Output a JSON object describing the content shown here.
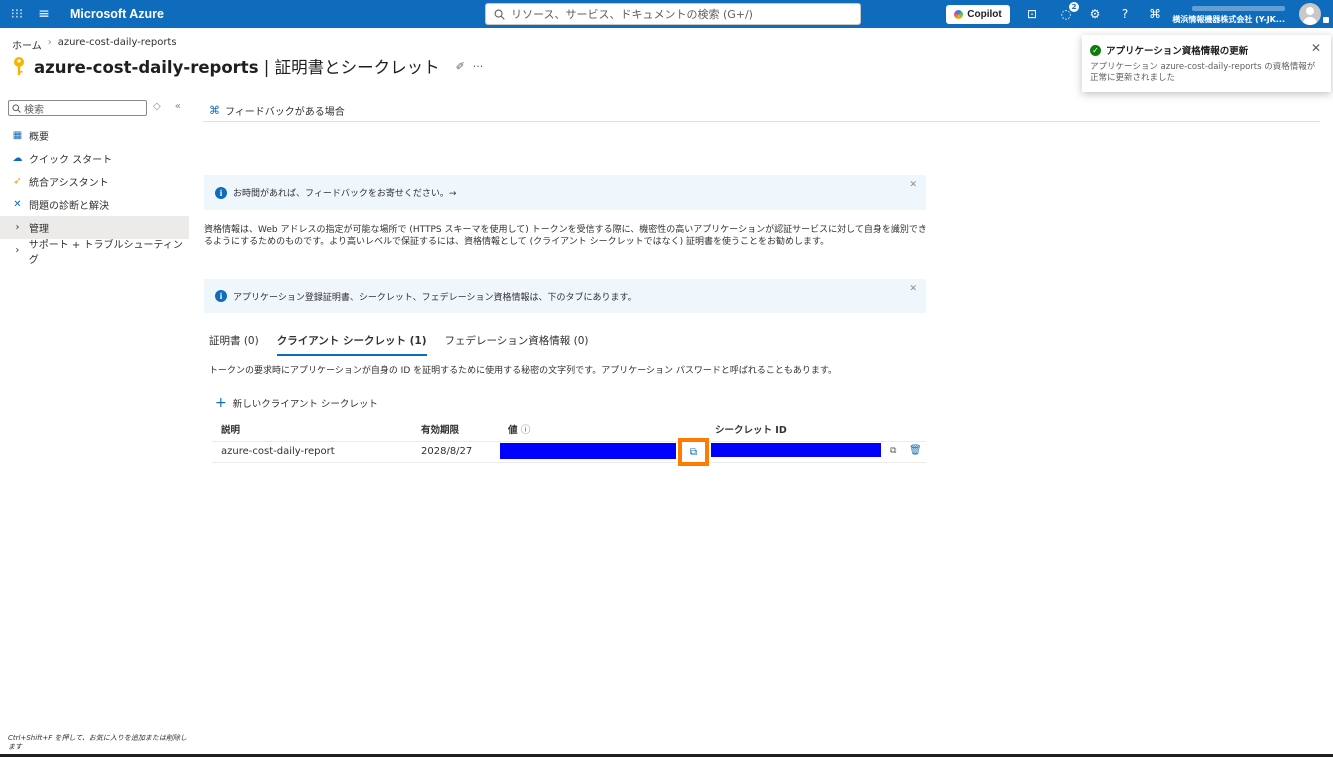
{
  "topbar": {
    "brand": "Microsoft Azure",
    "search_placeholder": "リソース、サービス、ドキュメントの検索 (G+/)",
    "copilot_label": "Copilot",
    "notifications_count": "2",
    "account_org": "横浜情報機器株式会社 (Y-JK..."
  },
  "breadcrumb": {
    "home": "ホーム",
    "current": "azure-cost-daily-reports"
  },
  "title": {
    "app_name": "azure-cost-daily-reports",
    "separator": " | ",
    "page": "証明書とシークレット"
  },
  "sidebar": {
    "search_placeholder": "検索",
    "items": [
      {
        "label": "概要",
        "icon": "overview-icon"
      },
      {
        "label": "クイック スタート",
        "icon": "cloud-icon"
      },
      {
        "label": "統合アシスタント",
        "icon": "rocket-icon"
      },
      {
        "label": "問題の診断と解決",
        "icon": "wrench-icon"
      },
      {
        "label": "管理",
        "icon": "chevron-right-icon"
      },
      {
        "label": "サポート + トラブルシューティング",
        "icon": "chevron-right-icon"
      }
    ]
  },
  "command_bar": {
    "feedback_label": "フィードバックがある場合"
  },
  "banners": {
    "feedback": "お時間があれば、フィードバックをお寄せください。→",
    "tabs_info": "アプリケーション登録証明書、シークレット、フェデレーション資格情報は、下のタブにあります。"
  },
  "description": "資格情報は、Web アドレスの指定が可能な場所で (HTTPS スキーマを使用して) トークンを受信する際に、機密性の高いアプリケーションが認証サービスに対して自身を識別できるようにするためのものです。より高いレベルで保証するには、資格情報として (クライアント シークレットではなく) 証明書を使うことをお勧めします。",
  "tabs": [
    {
      "label": "証明書 (0)"
    },
    {
      "label": "クライアント シークレット (1)"
    },
    {
      "label": "フェデレーション資格情報 (0)"
    }
  ],
  "tab_description": "トークンの要求時にアプリケーションが自身の ID を証明するために使用する秘密の文字列です。アプリケーション パスワードと呼ばれることもあります。",
  "new_secret_label": "新しいクライアント シークレット",
  "table": {
    "headers": {
      "description": "説明",
      "expires": "有効期限",
      "value": "値",
      "secret_id": "シークレット ID"
    },
    "rows": [
      {
        "description": "azure-cost-daily-report",
        "expires": "2028/8/27"
      }
    ]
  },
  "toast": {
    "title": "アプリケーション資格情報の更新",
    "message": "アプリケーション azure-cost-daily-reports の資格情報が正常に更新されました"
  },
  "statusbar": "Ctrl+Shift+F を押して、お気に入りを追加または削除します",
  "colors": {
    "azure_blue": "#0f6cbd",
    "highlight": "#ff7c00",
    "redaction": "#0000ff"
  }
}
